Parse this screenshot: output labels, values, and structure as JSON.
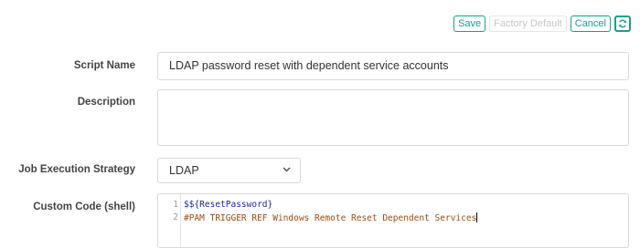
{
  "toolbar": {
    "save_label": "Save",
    "factory_default_label": "Factory Default",
    "cancel_label": "Cancel",
    "refresh_icon": "refresh-icon",
    "accent_color": "#1a9e8c"
  },
  "form": {
    "script_name": {
      "label": "Script Name",
      "value": "LDAP password reset with dependent service accounts"
    },
    "description": {
      "label": "Description",
      "value": ""
    },
    "job_execution_strategy": {
      "label": "Job Execution Strategy",
      "value": "LDAP"
    },
    "custom_code": {
      "label": "Custom Code (shell)",
      "lines": [
        {
          "number": "1",
          "var": "$${ResetPassword}"
        },
        {
          "number": "2",
          "comment": "#PAM TRIGGER REF Windows Remote Reset Dependent Services"
        }
      ]
    }
  }
}
